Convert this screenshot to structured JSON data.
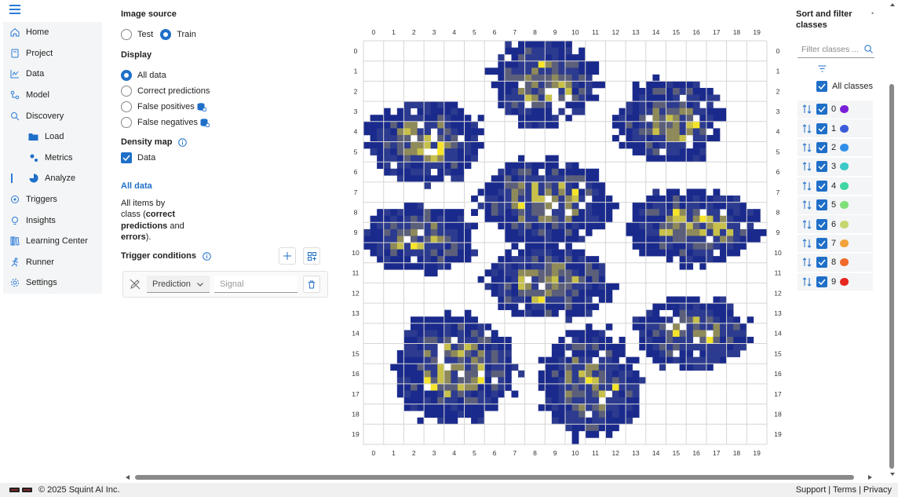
{
  "sidebar": {
    "items": [
      {
        "label": "Home",
        "icon": "home-icon"
      },
      {
        "label": "Project",
        "icon": "project-icon"
      },
      {
        "label": "Data",
        "icon": "data-icon"
      },
      {
        "label": "Model",
        "icon": "model-icon"
      },
      {
        "label": "Discovery",
        "icon": "discovery-icon"
      },
      {
        "label": "Load",
        "icon": "folder-icon"
      },
      {
        "label": "Metrics",
        "icon": "metrics-icon"
      },
      {
        "label": "Analyze",
        "icon": "pie-chart-icon"
      },
      {
        "label": "Triggers",
        "icon": "triggers-icon"
      },
      {
        "label": "Insights",
        "icon": "lightbulb-icon"
      },
      {
        "label": "Learning Center",
        "icon": "books-icon"
      },
      {
        "label": "Runner",
        "icon": "runner-icon"
      },
      {
        "label": "Settings",
        "icon": "gear-icon"
      }
    ]
  },
  "panel": {
    "image_source_title": "Image source",
    "test_label": "Test",
    "train_label": "Train",
    "display_title": "Display",
    "all_data_label": "All data",
    "correct_label": "Correct predictions",
    "fp_label": "False positives",
    "fn_label": "False negatives",
    "density_title": "Density map",
    "density_data_label": "Data",
    "info_title": "All data",
    "info_text_1": "All items by",
    "info_text_2a": "class (",
    "info_text_2b": "correct",
    "info_text_3": "predictions",
    "info_text_3b": " and",
    "info_text_4": "errors",
    "info_text_4b": ").",
    "trigger_title": "Trigger conditions",
    "prediction_select": "Prediction",
    "signal_placeholder": "Signal"
  },
  "right": {
    "title_1": "Sort and filter",
    "title_2": "classes",
    "filter_placeholder": "Filter classes ...",
    "all_classes_label": "All classes",
    "classes": [
      {
        "label": "0",
        "color": "#7a1fd6"
      },
      {
        "label": "1",
        "color": "#3b5bdb"
      },
      {
        "label": "2",
        "color": "#2f8fe8"
      },
      {
        "label": "3",
        "color": "#3cc9c9"
      },
      {
        "label": "4",
        "color": "#3ed6a2"
      },
      {
        "label": "5",
        "color": "#7fe07a"
      },
      {
        "label": "6",
        "color": "#c6d670"
      },
      {
        "label": "7",
        "color": "#f2a23a"
      },
      {
        "label": "8",
        "color": "#f26a2a"
      },
      {
        "label": "9",
        "color": "#e6261f"
      }
    ]
  },
  "chart_data": {
    "type": "heatmap",
    "x_ticks": [
      "0",
      "1",
      "2",
      "3",
      "4",
      "5",
      "6",
      "7",
      "8",
      "9",
      "10",
      "11",
      "12",
      "13",
      "14",
      "15",
      "16",
      "17",
      "18",
      "19"
    ],
    "y_ticks": [
      "0",
      "1",
      "2",
      "3",
      "4",
      "5",
      "6",
      "7",
      "8",
      "9",
      "10",
      "11",
      "12",
      "13",
      "14",
      "15",
      "16",
      "17",
      "18",
      "19"
    ],
    "xlim": [
      0,
      20
    ],
    "ylim": [
      0,
      20
    ],
    "grid": true,
    "colormap": [
      "#1a2a8c",
      "#2c3b8f",
      "#5b5f7a",
      "#8f8a5a",
      "#c7c04a",
      "#f5e42a"
    ],
    "clusters": [
      {
        "cx": 9.0,
        "cy": 2.1,
        "rx": 2.5,
        "ry": 2.1
      },
      {
        "cx": 15.2,
        "cy": 4.0,
        "rx": 2.6,
        "ry": 2.0
      },
      {
        "cx": 3.0,
        "cy": 5.0,
        "rx": 2.8,
        "ry": 2.0
      },
      {
        "cx": 9.0,
        "cy": 8.0,
        "rx": 3.2,
        "ry": 2.1
      },
      {
        "cx": 16.5,
        "cy": 9.2,
        "rx": 3.2,
        "ry": 1.8
      },
      {
        "cx": 2.8,
        "cy": 9.8,
        "rx": 2.7,
        "ry": 1.6
      },
      {
        "cx": 9.2,
        "cy": 12.0,
        "rx": 3.0,
        "ry": 1.8
      },
      {
        "cx": 16.3,
        "cy": 14.5,
        "rx": 2.7,
        "ry": 1.7
      },
      {
        "cx": 4.5,
        "cy": 16.2,
        "rx": 2.9,
        "ry": 2.6
      },
      {
        "cx": 11.2,
        "cy": 17.0,
        "rx": 2.4,
        "ry": 2.6
      }
    ]
  },
  "footer": {
    "copyright": "© 2025 Squint AI Inc.",
    "links": "Support | Terms | Privacy"
  }
}
